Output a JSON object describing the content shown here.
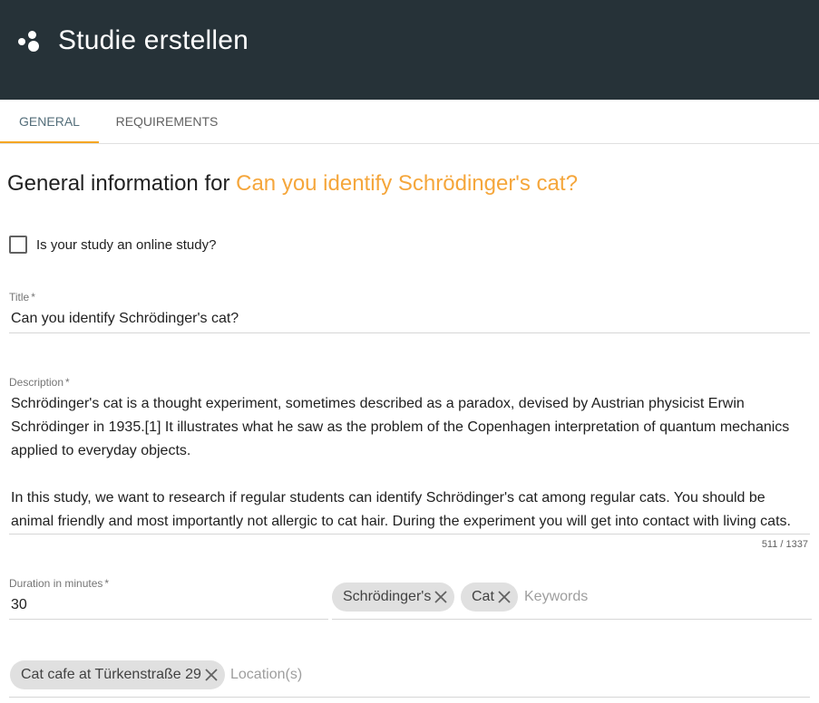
{
  "header": {
    "app_title": "Studie erstellen"
  },
  "tabs": [
    {
      "label": "General",
      "active": true
    },
    {
      "label": "Requirements",
      "active": false
    }
  ],
  "heading": {
    "prefix": "General information for ",
    "study_name": "Can you identify Schrödinger's cat?"
  },
  "online_study": {
    "label": "Is your study an online study?",
    "checked": false
  },
  "title_field": {
    "label": "Title",
    "required_mark": "*",
    "value": "Can you identify Schrödinger's cat?"
  },
  "description_field": {
    "label": "Description",
    "required_mark": "*",
    "paragraph1": "Schrödinger's cat is a thought experiment, sometimes described as a paradox, devised by Austrian physicist Erwin Schrödinger in 1935.[1] It illustrates what he saw as the problem of the Copenhagen interpretation of quantum mechanics applied to everyday objects.",
    "paragraph2": "In this study, we want to research if regular students can identify Schrödinger's cat among regular cats. You should be animal friendly and most importantly not allergic to cat hair. During the experiment you will get into contact with living cats.",
    "counter": "511 / 1337"
  },
  "duration_field": {
    "label": "Duration in minutes",
    "required_mark": "*",
    "value": "30"
  },
  "keywords": {
    "chips": [
      "Schrödinger's",
      "Cat"
    ],
    "placeholder": "Keywords"
  },
  "locations": {
    "chips": [
      "Cat cafe at Türkenstraße 29"
    ],
    "placeholder": "Location(s)"
  },
  "colors": {
    "toolbar": "#263238",
    "accent": "#f5a623",
    "tab_active": "#546e7a"
  },
  "icons": {
    "logo": "dots-logo-icon",
    "chip_remove": "close-icon"
  }
}
